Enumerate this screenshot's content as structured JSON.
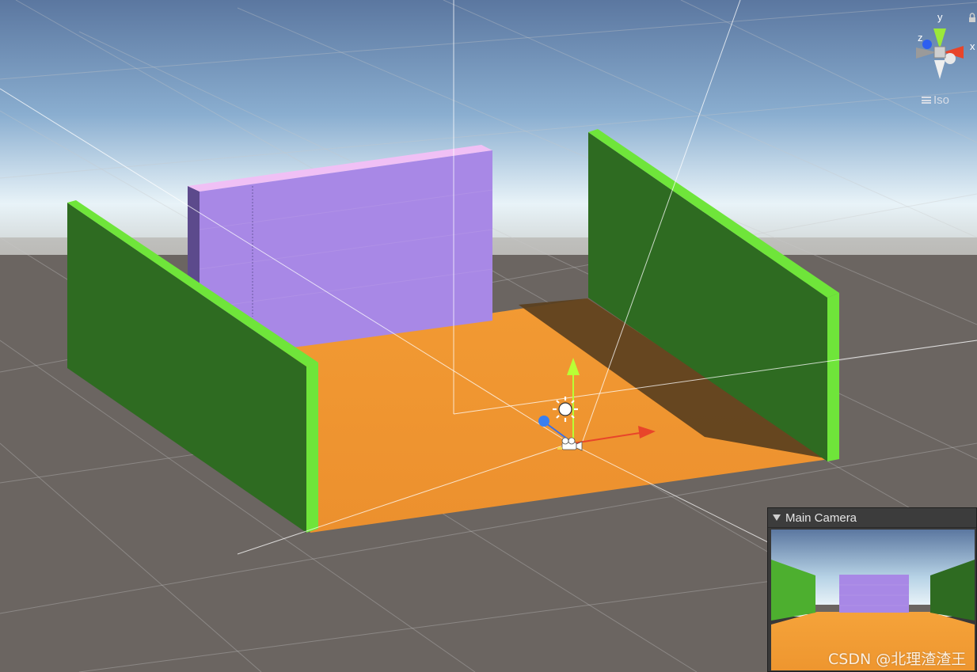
{
  "scene": {
    "colors": {
      "sky_top": "#5d7aa3",
      "sky_horizon": "#e6f1f7",
      "ground": "#6b6561",
      "floor": "#f0962f",
      "floor_shadow": "#5a3f1e",
      "wall_green": "#2e6b21",
      "wall_green_edge": "#6fe53a",
      "wall_purple": "#a888e6",
      "wall_purple_top": "#f0c0f5",
      "wall_purple_side": "#5c4a8c",
      "axis_x": "#e8452a",
      "axis_y": "#b9ff35",
      "axis_z": "#3a6fe6"
    },
    "orientation_gizmo": {
      "x_label": "x",
      "y_label": "y",
      "z_label": "z",
      "projection_label": "Iso"
    },
    "objects": {
      "directional_light_icon": "sun-icon",
      "camera_icon": "camera-icon",
      "lock_icon": "lock-icon"
    }
  },
  "camera_preview": {
    "title": "Main Camera"
  },
  "watermark": "CSDN @北理渣渣王"
}
